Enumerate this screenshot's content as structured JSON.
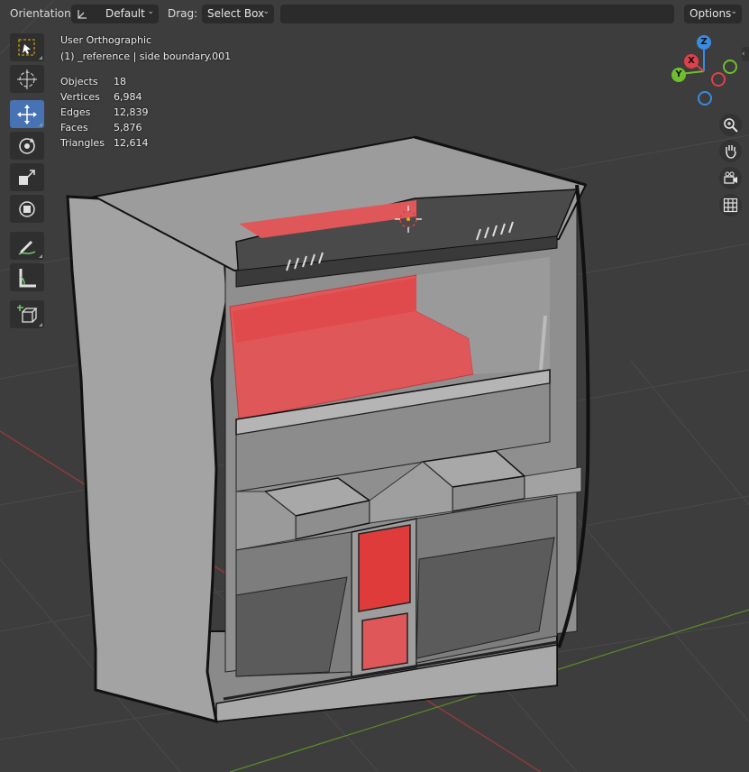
{
  "header": {
    "orientation_label": "Orientation:",
    "orientation_value": "Default",
    "drag_label": "Drag:",
    "drag_value": "Select Box",
    "options_label": "Options"
  },
  "viewport": {
    "view_name": "User Orthographic",
    "active_object": "(1) _reference | side boundary.001",
    "stats": [
      {
        "label": "Objects",
        "value": "18"
      },
      {
        "label": "Vertices",
        "value": "6,984"
      },
      {
        "label": "Edges",
        "value": "12,839"
      },
      {
        "label": "Faces",
        "value": "5,876"
      },
      {
        "label": "Triangles",
        "value": "12,614"
      }
    ]
  },
  "toolbar": {
    "active_tool": "move",
    "tools": [
      "select-box",
      "cursor",
      "move",
      "rotate",
      "scale",
      "transform",
      "annotate",
      "measure",
      "add-cube"
    ]
  },
  "gizmo": {
    "axis_z": "Z",
    "axis_y": "Y",
    "axis_x": "X",
    "colors": {
      "x": "#e0404a",
      "y": "#6fbf2d",
      "z": "#3a8be0"
    }
  },
  "colors": {
    "background": "#3d3d3d",
    "active_tool": "#4772b3",
    "selected_face": "#e0575a",
    "model_body": "#9b9b9b"
  }
}
